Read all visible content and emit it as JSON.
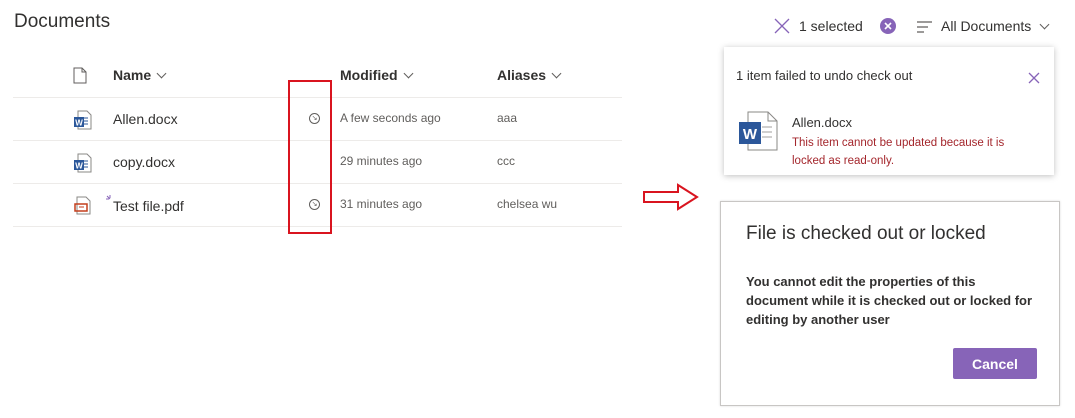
{
  "library": {
    "title": "Documents",
    "columns": {
      "name": "Name",
      "modified": "Modified",
      "aliases": "Aliases"
    },
    "rows": [
      {
        "name": "Allen.docx",
        "type": "word-doc-icon",
        "modified": "A few seconds ago",
        "aliases": "aaa",
        "checked_out": true
      },
      {
        "name": "copy.docx",
        "type": "word-doc-icon",
        "modified": "29 minutes ago",
        "aliases": "ccc",
        "checked_out": false
      },
      {
        "name": "Test file.pdf",
        "type": "pdf-icon",
        "modified": "31 minutes ago",
        "aliases": "chelsea wu",
        "checked_out": true
      }
    ]
  },
  "command_bar": {
    "selected": "1 selected",
    "view": "All Documents"
  },
  "toast": {
    "title": "1 item failed to undo check out",
    "file": "Allen.docx",
    "error": "This item cannot be updated because it is locked as read-only."
  },
  "dialog": {
    "title": "File is checked out or locked",
    "body": "You cannot edit the properties of this document while it is checked out or locked for editing by another user",
    "cancel": "Cancel"
  },
  "colors": {
    "accent": "#8764b8",
    "error": "#a4262c",
    "annotation": "#d9141f"
  }
}
